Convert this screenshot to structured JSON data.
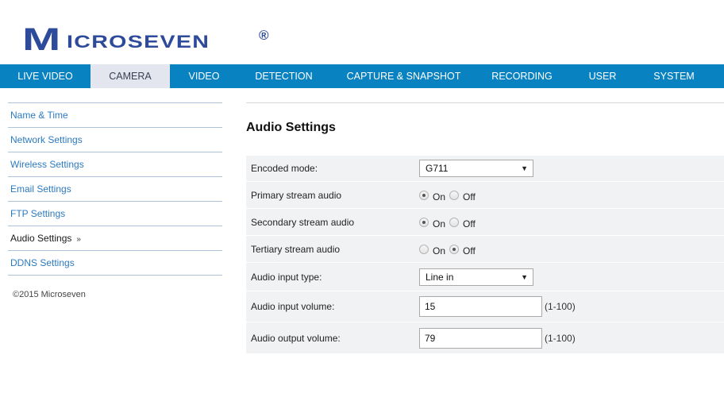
{
  "brand": {
    "logo_initial": "M",
    "logo_rest": "ICROSEVEN",
    "registered_mark": "®",
    "color": "#2e4a9a"
  },
  "nav": {
    "accent_color": "#0982c1",
    "items": [
      {
        "label": "LIVE VIDEO",
        "active": false
      },
      {
        "label": "CAMERA",
        "active": true
      },
      {
        "label": "VIDEO",
        "active": false
      },
      {
        "label": "DETECTION",
        "active": false
      },
      {
        "label": "CAPTURE & SNAPSHOT",
        "active": false
      },
      {
        "label": "RECORDING",
        "active": false
      },
      {
        "label": "USER",
        "active": false
      },
      {
        "label": "SYSTEM",
        "active": false
      }
    ]
  },
  "sidebar": {
    "items": [
      {
        "label": "Name & Time",
        "active": false
      },
      {
        "label": "Network Settings",
        "active": false
      },
      {
        "label": "Wireless Settings",
        "active": false
      },
      {
        "label": "Email Settings",
        "active": false
      },
      {
        "label": "FTP Settings",
        "active": false
      },
      {
        "label": "Audio Settings",
        "active": true,
        "indicator": "»"
      },
      {
        "label": "DDNS Settings",
        "active": false
      }
    ],
    "copyright": "©2015 Microseven"
  },
  "main": {
    "title": "Audio Settings",
    "fields": {
      "encoded_mode": {
        "label": "Encoded mode:",
        "value": "G711",
        "caret": "▼"
      },
      "primary_stream": {
        "label": "Primary stream audio",
        "on_label": "On",
        "off_label": "Off",
        "value": "On"
      },
      "secondary_stream": {
        "label": "Secondary stream audio",
        "on_label": "On",
        "off_label": "Off",
        "value": "On"
      },
      "tertiary_stream": {
        "label": "Tertiary stream audio",
        "on_label": "On",
        "off_label": "Off",
        "value": "Off"
      },
      "input_type": {
        "label": "Audio input type:",
        "value": "Line in",
        "caret": "▼"
      },
      "input_volume": {
        "label": "Audio input volume:",
        "value": "15",
        "range": "(1-100)"
      },
      "output_volume": {
        "label": "Audio output volume:",
        "value": "79",
        "range": "(1-100)"
      }
    }
  }
}
